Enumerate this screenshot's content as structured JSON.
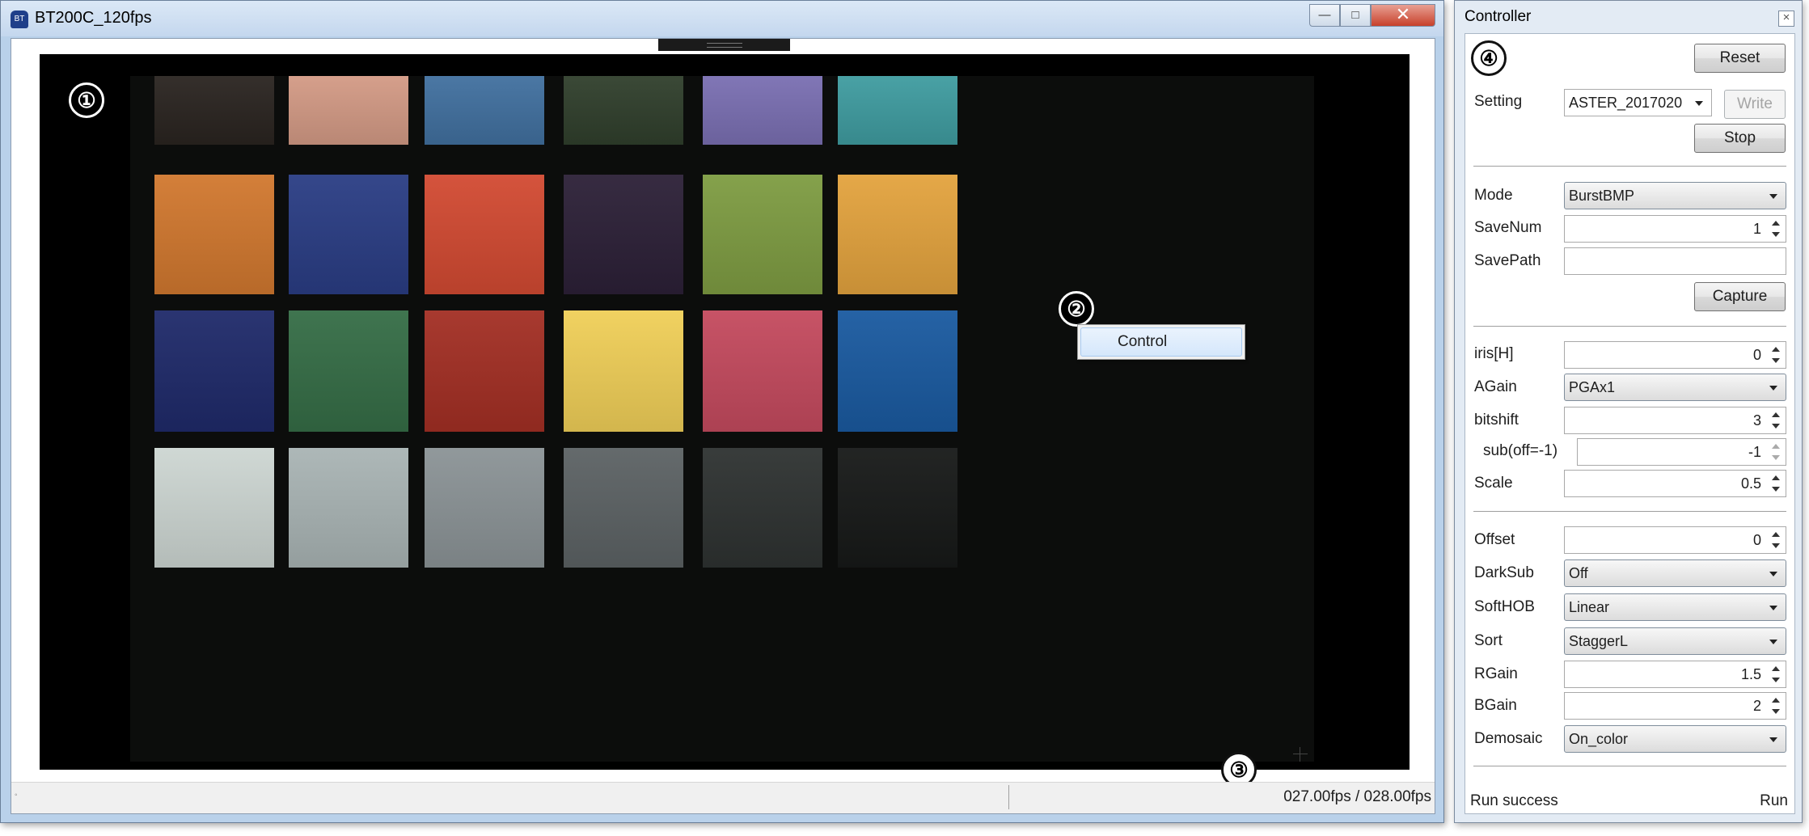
{
  "main_window": {
    "title": "BT200C_120fps",
    "icon": "camera-app-icon",
    "buttons": {
      "minimize": "minimize-icon",
      "maximize": "maximize-icon",
      "close": "close-icon"
    },
    "markers": [
      "①",
      "②",
      "③"
    ],
    "context_menu": {
      "item": "Control"
    },
    "status": {
      "left": "◦",
      "fps": "027.00fps / 028.00fps"
    },
    "color_chart": {
      "rows": [
        [
          "#2a2420",
          "#d39a85",
          "#41709f",
          "#303f2c",
          "#7a6fb2",
          "#3f9ca0"
        ],
        [
          "#d1782f",
          "#2a3d84",
          "#d24a32",
          "#2c2037",
          "#7e9c42",
          "#e3a33e"
        ],
        [
          "#1f2a6a",
          "#356d46",
          "#a32f24",
          "#f0cf58",
          "#c44a5e",
          "#1a5aa0"
        ],
        [
          "#cdd6d2",
          "#a9b4b4",
          "#8b9396",
          "#5c6264",
          "#2e3231",
          "#171918"
        ]
      ]
    }
  },
  "controller": {
    "title": "Controller",
    "close": "close-icon",
    "marker": "④",
    "reset": "Reset",
    "setting": {
      "label": "Setting",
      "value": "ASTER_2017020",
      "write": "Write",
      "stop": "Stop"
    },
    "mode": {
      "label": "Mode",
      "value": "BurstBMP"
    },
    "savenum": {
      "label": "SaveNum",
      "value": "1"
    },
    "savepath": {
      "label": "SavePath",
      "value": ""
    },
    "capture": "Capture",
    "iris": {
      "label": "iris[H]",
      "value": "0"
    },
    "again": {
      "label": "AGain",
      "value": "PGAx1"
    },
    "bitshift": {
      "label": "bitshift",
      "value": "3"
    },
    "sub": {
      "label": "sub(off=-1)",
      "value": "-1"
    },
    "scale": {
      "label": "Scale",
      "value": "0.5"
    },
    "offset": {
      "label": "Offset",
      "value": "0"
    },
    "darksub": {
      "label": "DarkSub",
      "value": "Off"
    },
    "softhob": {
      "label": "SoftHOB",
      "value": "Linear"
    },
    "sort": {
      "label": "Sort",
      "value": "StaggerL"
    },
    "rgain": {
      "label": "RGain",
      "value": "1.5"
    },
    "bgain": {
      "label": "BGain",
      "value": "2"
    },
    "demosaic": {
      "label": "Demosaic",
      "value": "On_color"
    },
    "status": {
      "left": "Run success",
      "right": "Run"
    }
  }
}
